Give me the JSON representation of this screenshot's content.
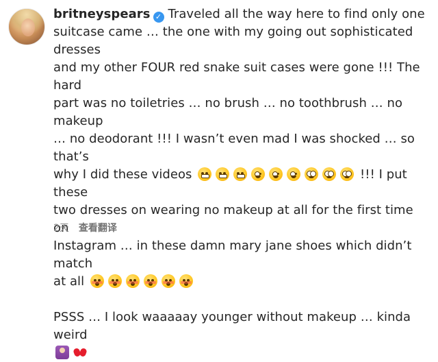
{
  "post": {
    "username": "britneyspears",
    "verified": true,
    "lines": [
      "Traveled all the way here to find only one",
      "suitcase came … the one with my going out sophisticated dresses",
      "and my other FOUR red snake suit cases were gone !!! The hard",
      "part was no toiletries … no brush … no toothbrush … no makeup",
      "… no deodorant !!! I wasn’t even mad I was shocked … so that’s",
      "why I did these videos",
      "!!! I put these",
      "two dresses on wearing no makeup at all for the first time on",
      "Instagram … in these damn mary jane shoes which didn’t match",
      "at all",
      "PSSS … I look waaaaay younger without makeup … kinda weird"
    ],
    "emoji_groups": {
      "videos_emojis": [
        "grimace",
        "grimace",
        "grimace",
        "zany",
        "zany",
        "zany",
        "nerd",
        "nerd",
        "nerd"
      ],
      "at_all_emojis": [
        "flushed",
        "flushed",
        "flushed",
        "flushed",
        "flushed",
        "flushed"
      ],
      "end_emojis": [
        "person",
        "bow"
      ]
    },
    "footer": {
      "time_ago": "2天",
      "translate_label": "查看翻译"
    }
  }
}
